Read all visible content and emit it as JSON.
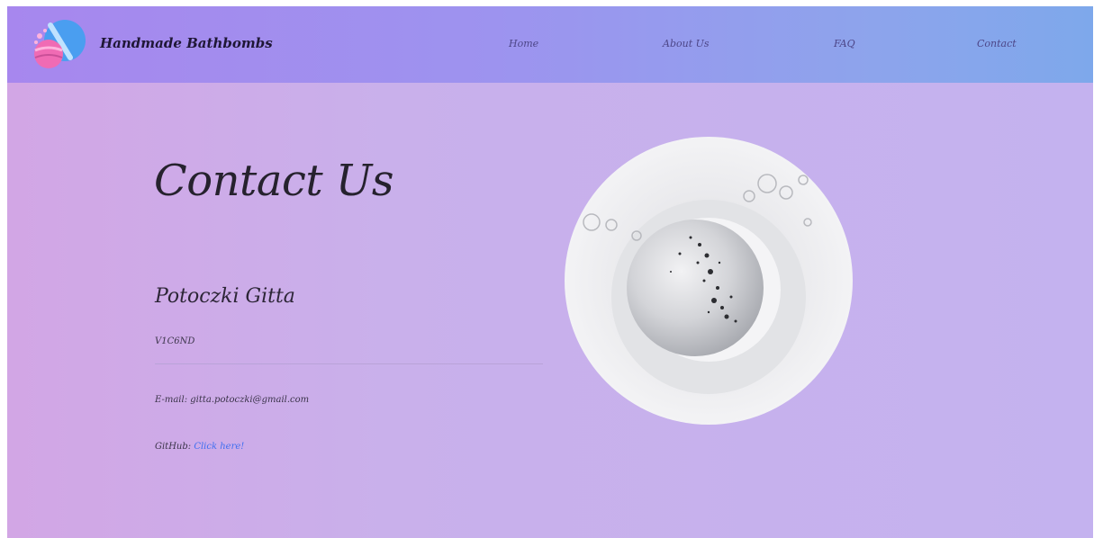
{
  "header": {
    "brand_name": "Handmade Bathbombs",
    "logo_icon": "bathbomb-logo-icon",
    "nav": [
      {
        "label": "Home"
      },
      {
        "label": "About Us"
      },
      {
        "label": "FAQ"
      },
      {
        "label": "Contact"
      }
    ]
  },
  "main": {
    "title": "Contact Us",
    "name": "Potoczki Gitta",
    "code": "V1C6ND",
    "email_label": "E-mail:",
    "email": "gitta.potoczki@gmail.com",
    "github_label": "GitHub:",
    "github_link": "Click here!",
    "image_icon": "bathbomb-foam-photo"
  },
  "colors": {
    "nav_gradient_start": "#a787ee",
    "nav_gradient_end": "#7ea8eb",
    "page_background": "#c9b0eb",
    "link": "#3f6ff0",
    "text_dark": "#26222e"
  }
}
